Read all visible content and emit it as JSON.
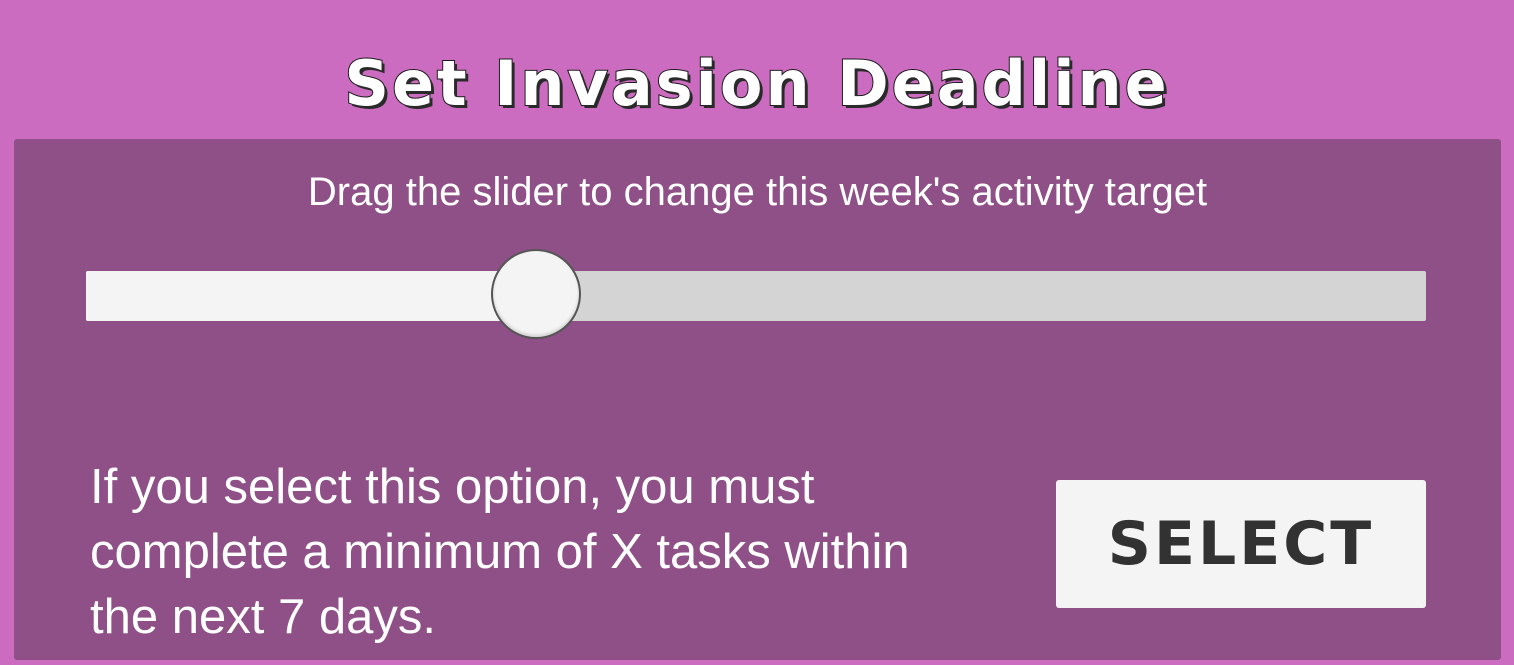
{
  "header": {
    "title": "Set Invasion Deadline"
  },
  "panel": {
    "instruction": "Drag the slider to change this week's activity target",
    "slider": {
      "value_fraction": 0.336,
      "fill_color": "#f4f4f4",
      "track_color": "#d4d4d4"
    },
    "description": "If you select this option, you must complete a minimum of X tasks within the next 7 days.",
    "select_label": "SELECT"
  },
  "colors": {
    "background": "#cc6cc0",
    "panel": "#8e5087",
    "text": "#ffffff",
    "button_text": "#323232"
  }
}
